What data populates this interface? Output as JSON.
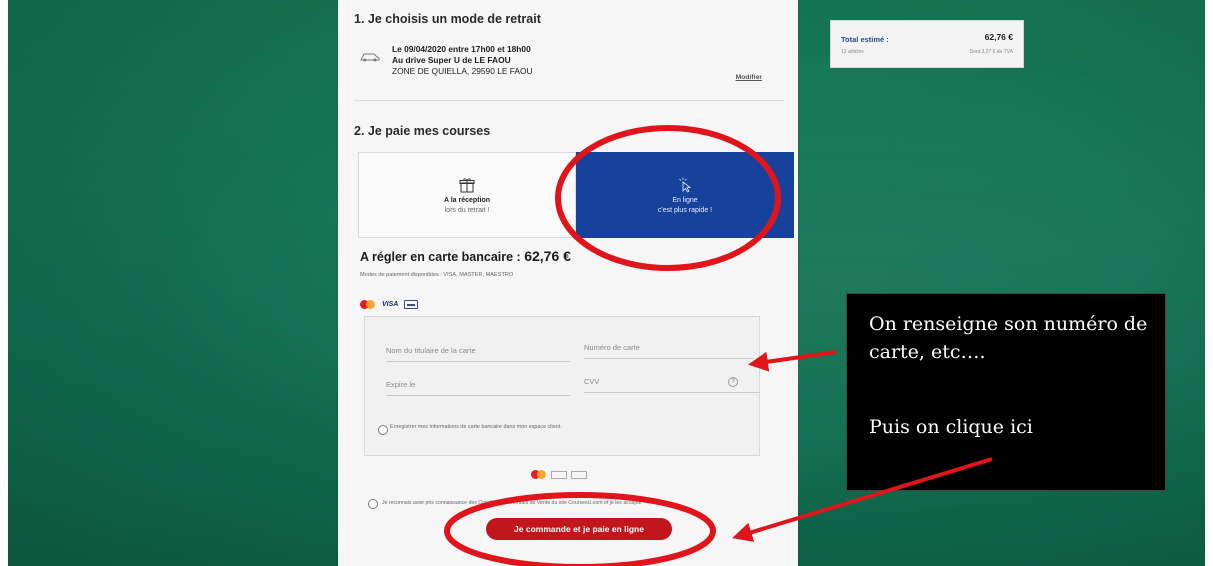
{
  "retrait": {
    "title": "1. Je choisis un mode de retrait",
    "line1": "Le 09/04/2020 entre 17h00 et 18h00",
    "line2": "Au drive Super U de LE FAOU",
    "line3": "ZONE DE QUIELLA, 29590 LE FAOU",
    "modify": "Modifier"
  },
  "paiement": {
    "title": "2. Je paie mes courses",
    "option_reception": {
      "label": "A la réception",
      "sub": "lors du retrait !"
    },
    "option_online": {
      "label": "En ligne",
      "sub": "c'est plus rapide !"
    },
    "amount_label": "A régler en carte bancaire : ",
    "amount": "62,76 €",
    "modes_text": "Modes de paiement disponibles : VISA, MASTER, MAESTRO",
    "visa": "VISA"
  },
  "card_form": {
    "holder_placeholder": "Nom du titulaire de la carte",
    "number_placeholder": "Numéro de carte",
    "expiry_placeholder": "Expire le",
    "cvv_placeholder": "CVV",
    "help": "?",
    "save_text": "Enregistrer mes informations de carte bancaire dans mon espace client."
  },
  "footer": {
    "cgv_text": "Je reconnais avoir pris connaissance des Conditions Générales de Vente du site CoursesU.com et je les accepte",
    "order_button": "Je commande et je paie en ligne"
  },
  "summary": {
    "label": "Total estimé :",
    "value": "62,76 €",
    "articles": "12 articles",
    "tva": "Dont 3,27 € de TVA"
  },
  "annotation": {
    "text1": "On renseigne son numéro de carte, etc….",
    "text2": "Puis on clique ici",
    "color": "#e0141b"
  }
}
